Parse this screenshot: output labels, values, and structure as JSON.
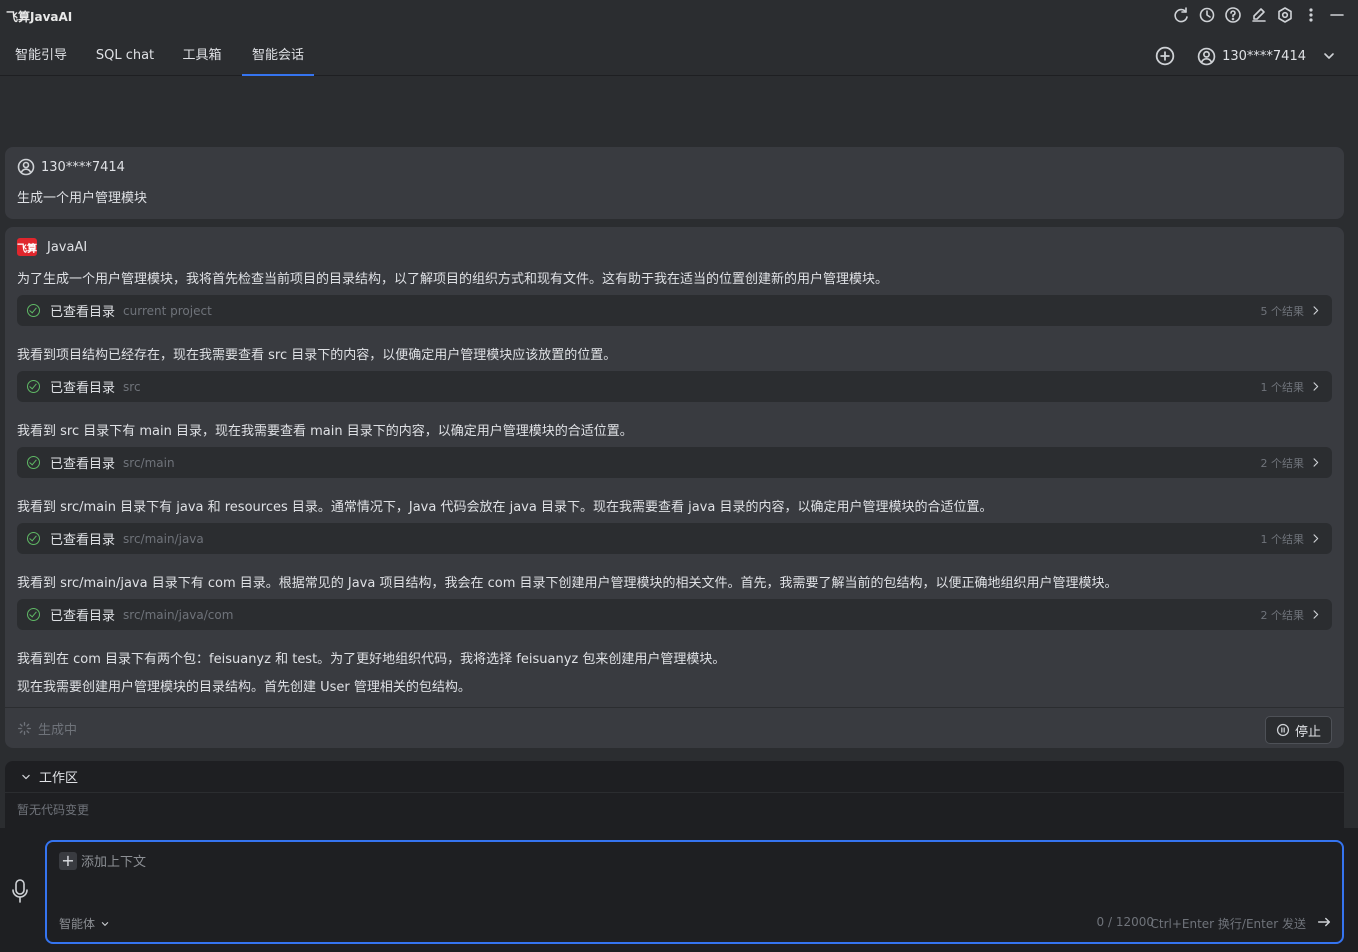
{
  "app": {
    "title": "飞算JavaAI"
  },
  "tabs": [
    {
      "label": "智能引导"
    },
    {
      "label": "SQL chat"
    },
    {
      "label": "工具箱"
    },
    {
      "label": "智能会话"
    }
  ],
  "user": {
    "name": "130****7414"
  },
  "user_message": {
    "author": "130****7414",
    "text": "生成一个用户管理模块"
  },
  "ai_message": {
    "author": "JavaAI",
    "logo_text": "飞算",
    "paragraphs": [
      "为了生成一个用户管理模块，我将首先检查当前项目的目录结构，以了解项目的组织方式和现有文件。这有助于我在适当的位置创建新的用户管理模块。",
      "我看到项目结构已经存在，现在我需要查看 src 目录下的内容，以便确定用户管理模块应该放置的位置。",
      "我看到 src 目录下有 main 目录，现在我需要查看 main 目录下的内容，以确定用户管理模块的合适位置。",
      "我看到 src/main 目录下有 java 和 resources 目录。通常情况下，Java 代码会放在 java 目录下。现在我需要查看 java 目录的内容，以确定用户管理模块的合适位置。",
      "我看到 src/main/java 目录下有 com 目录。根据常见的 Java 项目结构，我会在 com 目录下创建用户管理模块的相关文件。首先，我需要了解当前的包结构，以便正确地组织用户管理模块。",
      "我看到在 com 目录下有两个包：feisuanyz 和 test。为了更好地组织代码，我将选择 feisuanyz 包来创建用户管理模块。",
      "现在我需要创建用户管理模块的目录结构。首先创建 User 管理相关的包结构。"
    ],
    "tools": [
      {
        "label": "已查看目录",
        "path": "current project",
        "count": "5 个结果"
      },
      {
        "label": "已查看目录",
        "path": "src",
        "count": "1 个结果"
      },
      {
        "label": "已查看目录",
        "path": "src/main",
        "count": "2 个结果"
      },
      {
        "label": "已查看目录",
        "path": "src/main/java",
        "count": "1 个结果"
      },
      {
        "label": "已查看目录",
        "path": "src/main/java/com",
        "count": "2 个结果"
      }
    ],
    "status": "生成中",
    "stop_label": "停止"
  },
  "workspace": {
    "title": "工作区",
    "empty": "暂无代码变更"
  },
  "input": {
    "add_context": "添加上下文",
    "agent": "智能体",
    "counter": "0 / 12000",
    "hint": "Ctrl+Enter 换行/Enter 发送"
  },
  "colors": {
    "accent": "#3574f0",
    "success": "#5fb865",
    "brand": "#e0262d"
  }
}
